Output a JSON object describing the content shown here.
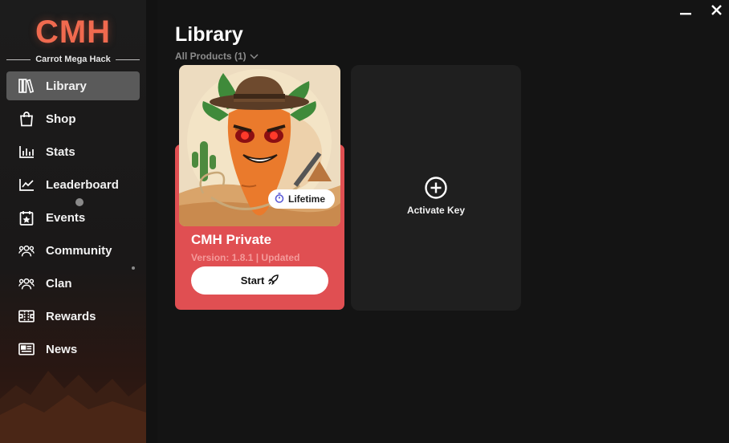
{
  "app": {
    "logo": "CMH",
    "subtitle": "Carrot Mega Hack"
  },
  "sidebar": {
    "items": [
      {
        "label": "Library",
        "icon": "books-icon",
        "active": true
      },
      {
        "label": "Shop",
        "icon": "shopping-bag-icon"
      },
      {
        "label": "Stats",
        "icon": "bar-chart-icon"
      },
      {
        "label": "Leaderboard",
        "icon": "trend-line-icon"
      },
      {
        "label": "Events",
        "icon": "calendar-star-icon"
      },
      {
        "label": "Community",
        "icon": "users-group-icon"
      },
      {
        "label": "Clan",
        "icon": "users-group-icon"
      },
      {
        "label": "Rewards",
        "icon": "ticket-icon"
      },
      {
        "label": "News",
        "icon": "newspaper-icon"
      }
    ]
  },
  "main": {
    "title": "Library",
    "filter": "All Products (1)",
    "product": {
      "name": "CMH Private",
      "version": "Version: 1.8.1 | Updated",
      "badge": "Lifetime",
      "start_label": "Start"
    },
    "activate_label": "Activate Key"
  },
  "colors": {
    "accent": "#e04f52",
    "logo": "#f06a4f",
    "active_nav": "#5a5a5a"
  }
}
